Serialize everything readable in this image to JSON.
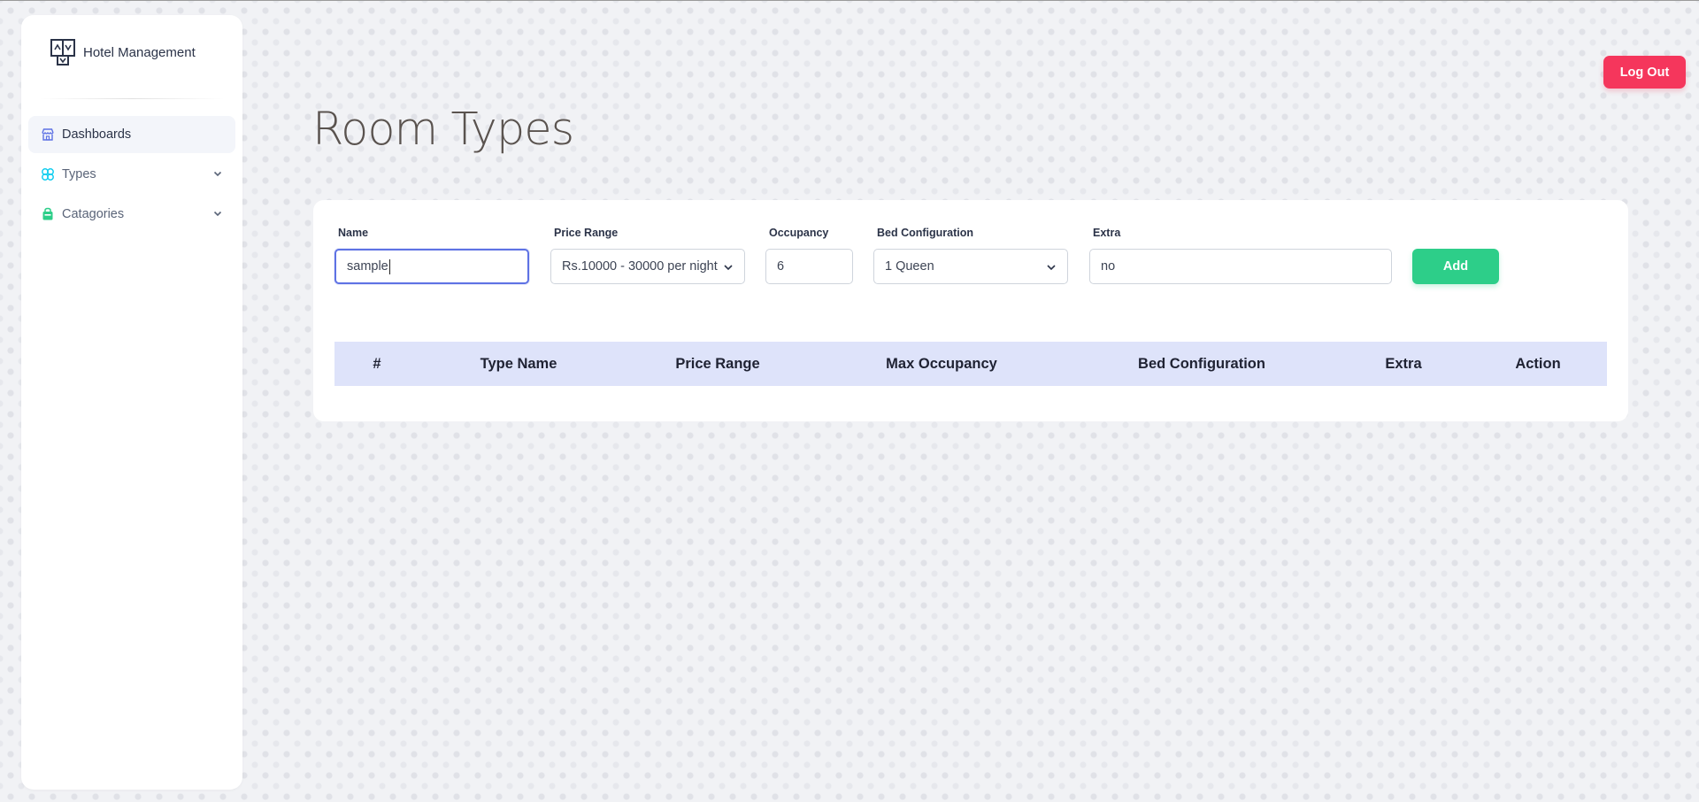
{
  "app": {
    "brand": "Hotel Management",
    "logout_label": "Log Out"
  },
  "sidebar": {
    "items": [
      {
        "label": "Dashboards",
        "icon": "store-icon",
        "active": true
      },
      {
        "label": "Types",
        "icon": "types-icon",
        "expandable": true
      },
      {
        "label": "Catagories",
        "icon": "bag-icon",
        "expandable": true
      }
    ]
  },
  "page": {
    "title": "Room Types"
  },
  "form": {
    "name": {
      "label": "Name",
      "value": "sample"
    },
    "price_range": {
      "label": "Price Range",
      "selected": "Rs.10000 - 30000 per night"
    },
    "occupancy": {
      "label": "Occupancy",
      "value": "6"
    },
    "bed_configuration": {
      "label": "Bed Configuration",
      "selected": "1 Queen"
    },
    "extra": {
      "label": "Extra",
      "value": "no"
    },
    "add_label": "Add"
  },
  "table": {
    "columns": [
      "#",
      "Type Name",
      "Price Range",
      "Max Occupancy",
      "Bed Configuration",
      "Extra",
      "Action"
    ],
    "rows": []
  },
  "colors": {
    "accent": "#5e72e4",
    "danger": "#f5365c",
    "success": "#2dce89",
    "table_header": "#dee3fa"
  }
}
